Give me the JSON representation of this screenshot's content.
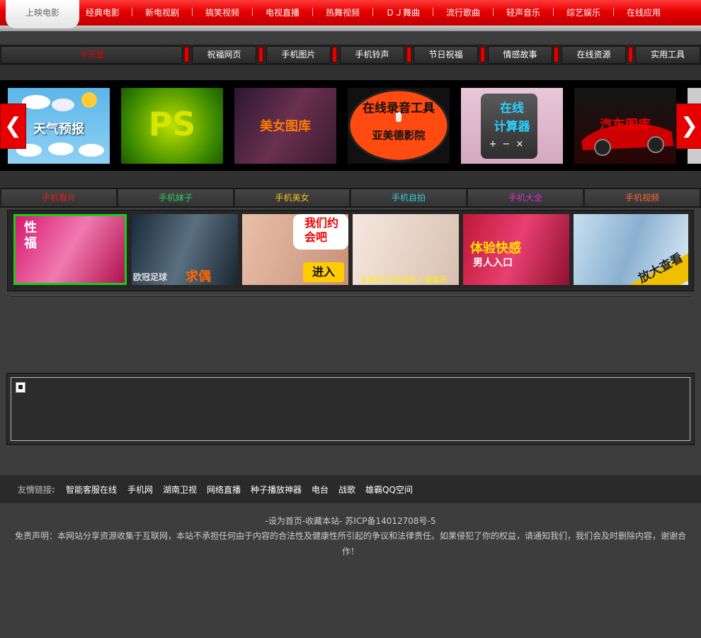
{
  "topnav": {
    "items": [
      "上映电影",
      "经典电影",
      "新电视剧",
      "搞笑视频",
      "电视直播",
      "热舞视频",
      "ＤＪ舞曲",
      "流行歌曲",
      "轻声音乐",
      "综艺娱乐",
      "在线应用"
    ],
    "active_index": 0
  },
  "tabs": {
    "items": [
      "今天是",
      "祝福网页",
      "手机图片",
      "手机铃声",
      "节日祝福",
      "情感故事",
      "在线资源",
      "实用工具"
    ]
  },
  "carousel": {
    "prev": "❮",
    "next": "❯",
    "items": [
      {
        "label": "天气预报"
      },
      {
        "label": "PS"
      },
      {
        "label": "美女图库"
      },
      {
        "label": "在线录音工具",
        "sub": "亚美德影院"
      },
      {
        "label": "在线",
        "sub": "计算器"
      },
      {
        "label": "汽车图库"
      }
    ]
  },
  "categories": {
    "items": [
      {
        "label": "手机看片",
        "color": "#e02020"
      },
      {
        "label": "手机妹子",
        "color": "#33cc66"
      },
      {
        "label": "手机美女",
        "color": "#f0c020"
      },
      {
        "label": "手机自拍",
        "color": "#33ccdd"
      },
      {
        "label": "手机大全",
        "color": "#cc33cc"
      },
      {
        "label": "手机视频",
        "color": "#ff6633"
      }
    ]
  },
  "gallery": {
    "items": [
      {
        "label": "性福"
      },
      {
        "label": "欧冠足球",
        "sub": "求偶"
      },
      {
        "label": "我们约会吧",
        "sub": "进入"
      },
      {
        "label": "未满16岁未成年人请离开"
      },
      {
        "label": "体验快感",
        "sub": "男人入口"
      },
      {
        "label": "放大查看"
      }
    ]
  },
  "links": {
    "label": "友情链接:",
    "items": [
      "智能客服在线",
      "手机网",
      "湖南卫视",
      "网络直播",
      "种子播放神器",
      "电台",
      "战歌",
      "雄霸QQ空间"
    ]
  },
  "footer": {
    "line1": "-设为首页-收藏本站- 苏ICP备14012708号-5",
    "disclaimer": "免责声明：本网站分享资源收集于互联网，本站不承担任何由于内容的合法性及健康性所引起的争议和法律责任。如果侵犯了你的权益，请通知我们，我们会及时删除内容，谢谢合作！"
  }
}
